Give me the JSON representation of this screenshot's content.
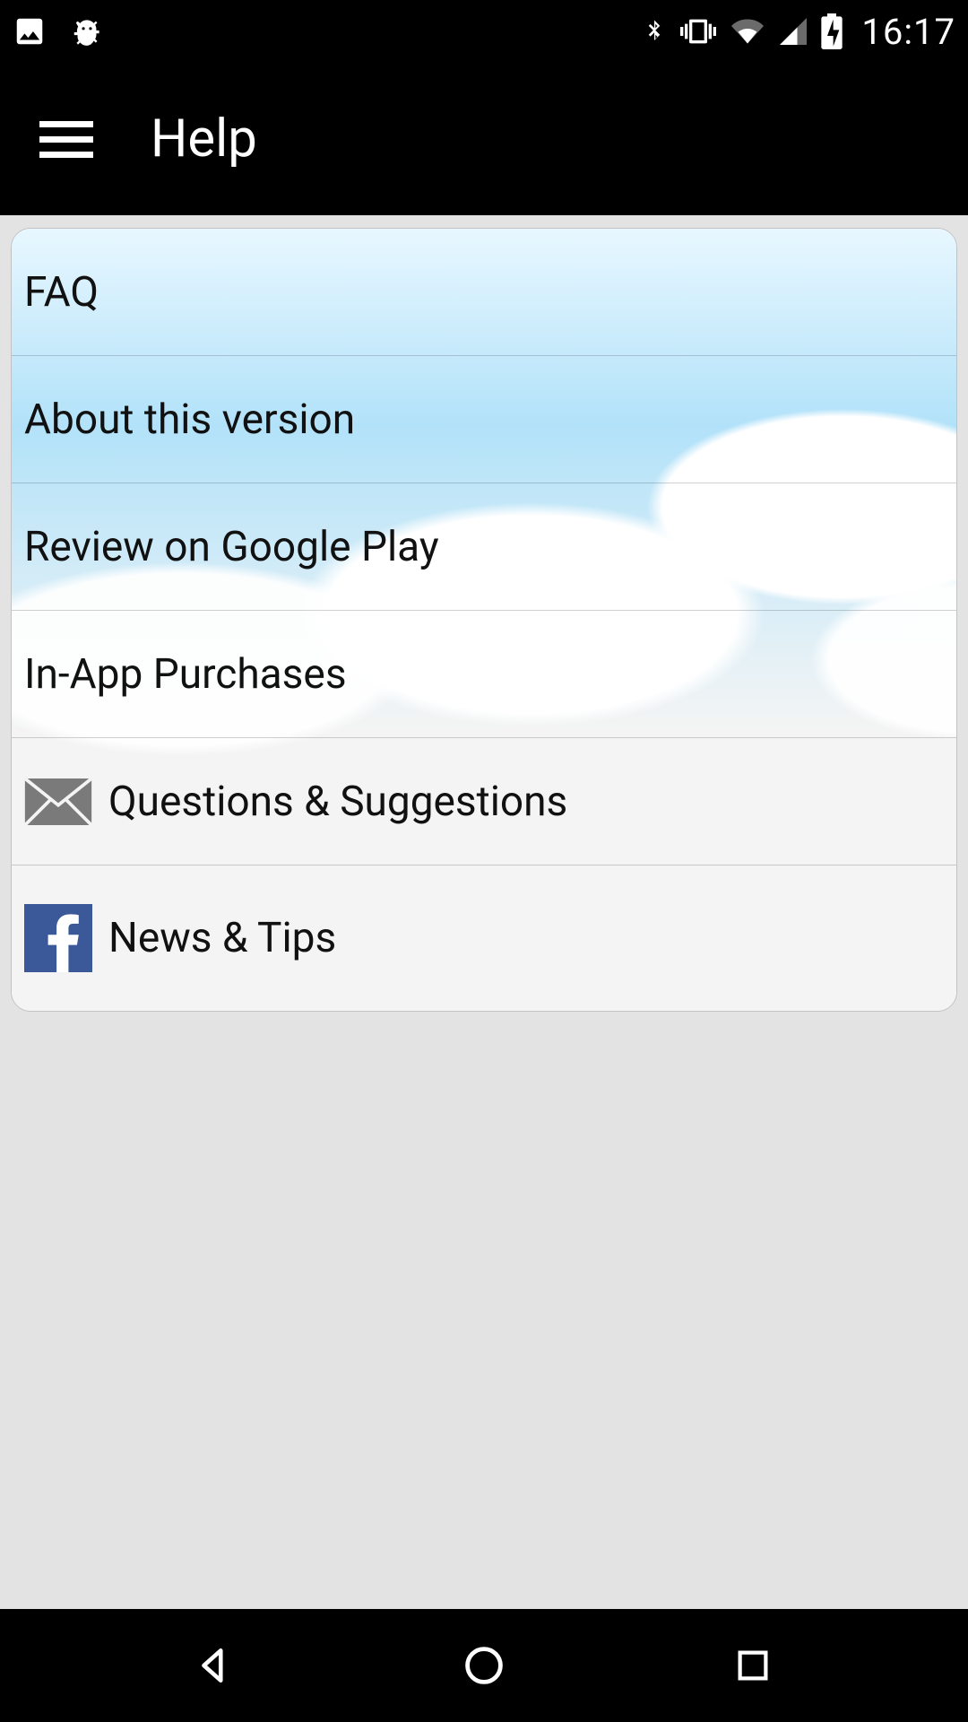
{
  "status_bar": {
    "time": "16:17"
  },
  "app_bar": {
    "title": "Help"
  },
  "menu": {
    "items": [
      {
        "label": "FAQ",
        "icon": null
      },
      {
        "label": "About this version",
        "icon": null
      },
      {
        "label": "Review on Google Play",
        "icon": null
      },
      {
        "label": "In-App Purchases",
        "icon": null
      },
      {
        "label": "Questions & Suggestions",
        "icon": "mail"
      },
      {
        "label": "News & Tips",
        "icon": "facebook"
      }
    ]
  }
}
